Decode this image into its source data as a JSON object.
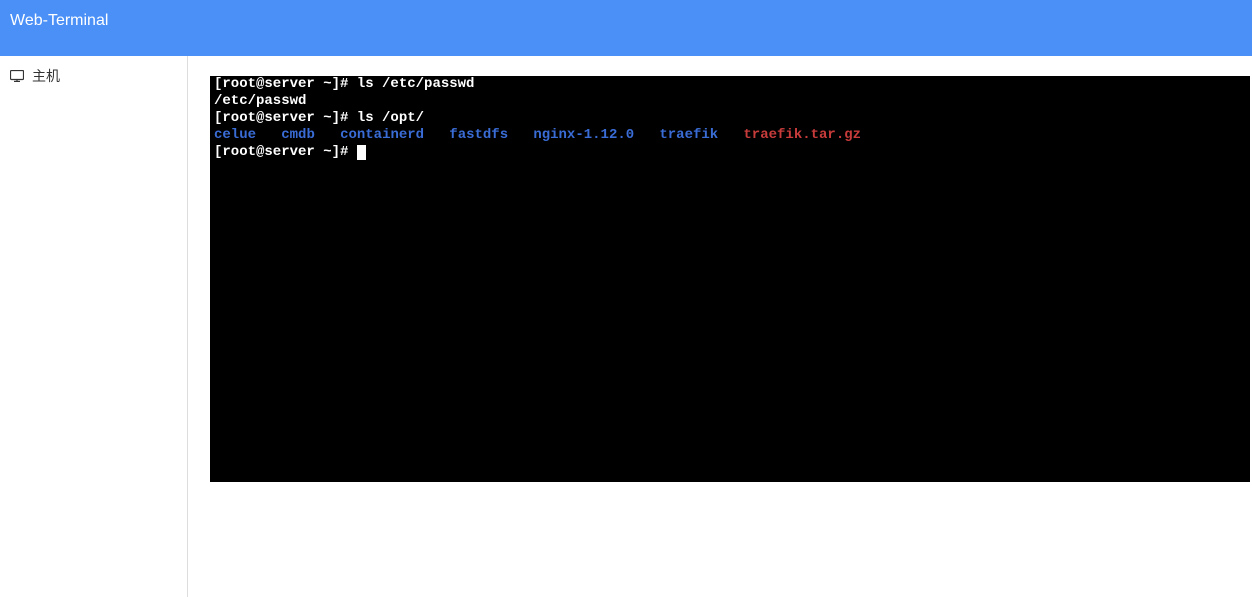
{
  "header": {
    "title": "Web-Terminal"
  },
  "sidebar": {
    "items": [
      {
        "label": "主机",
        "icon": "monitor-icon"
      }
    ]
  },
  "terminal": {
    "prompt": "[root@server ~]# ",
    "lines": {
      "cmd1": "ls /etc/passwd",
      "out1": "/etc/passwd",
      "cmd2": "ls /opt/",
      "opt_items": {
        "celue": "celue",
        "cmdb": "cmdb",
        "containerd": "containerd",
        "fastdfs": "fastdfs",
        "nginx": "nginx-1.12.0",
        "traefik": "traefik",
        "traefik_tar": "traefik.tar.gz"
      },
      "gap2": "   ",
      "gap3": "   ",
      "gap4": "   ",
      "gap5": "   ",
      "gap6": "   ",
      "gap7": "   "
    }
  }
}
